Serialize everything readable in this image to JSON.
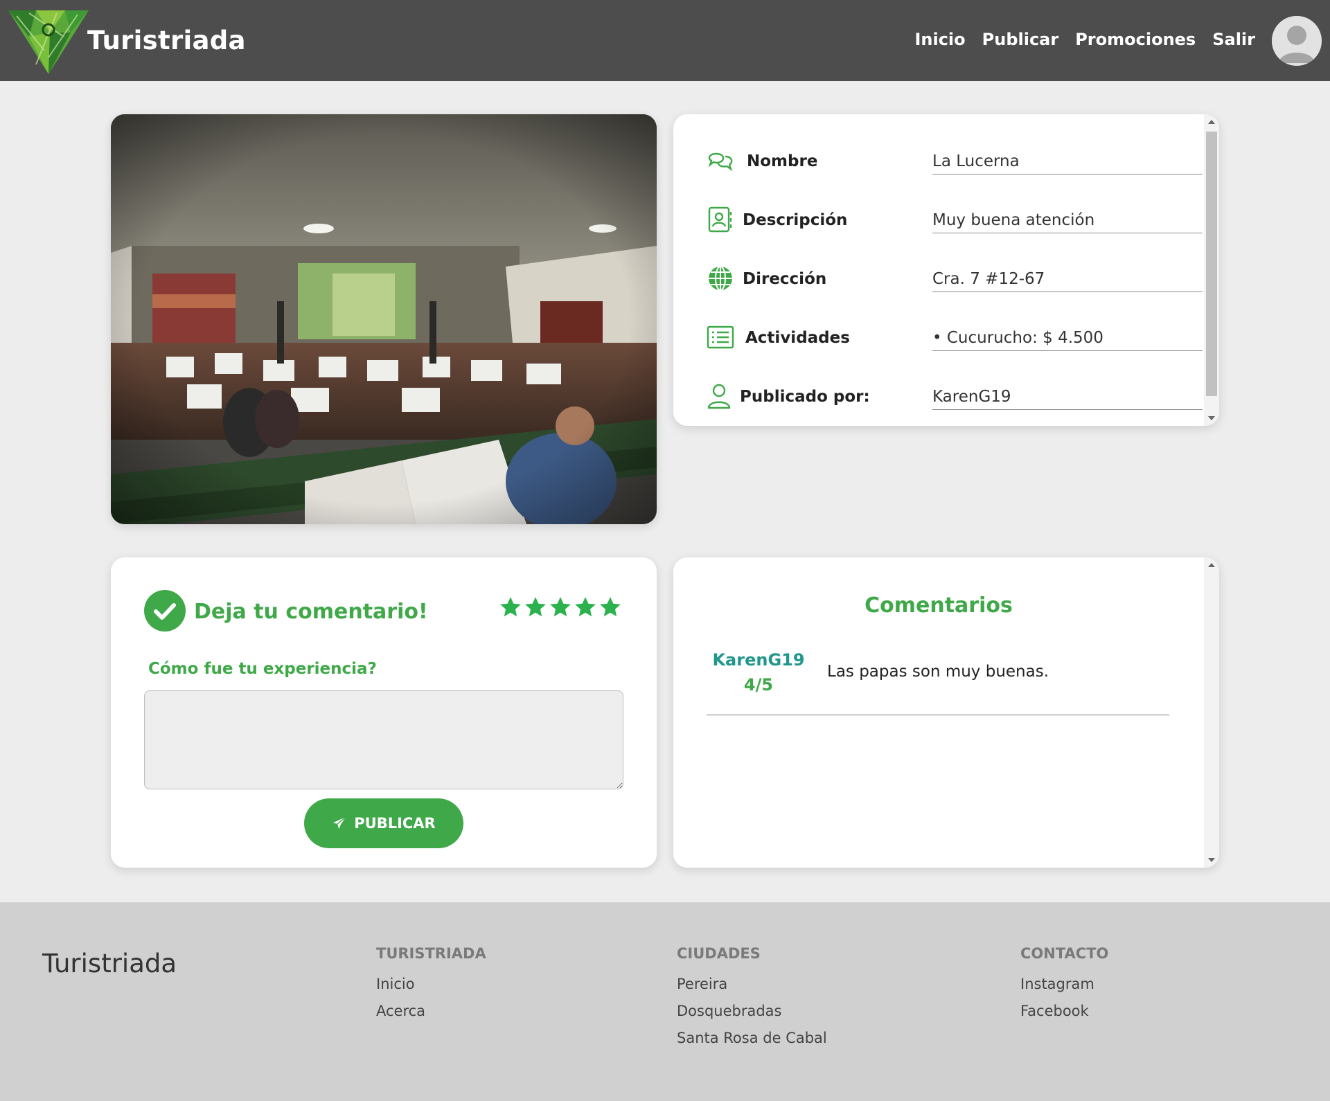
{
  "header": {
    "brand": "Turistriada",
    "nav": [
      {
        "label": "Inicio"
      },
      {
        "label": "Publicar"
      },
      {
        "label": "Promociones"
      },
      {
        "label": "Salir"
      }
    ],
    "avatar_icon": "user-avatar-icon"
  },
  "place": {
    "fields": [
      {
        "icon": "chat-bubbles-icon",
        "label": "Nombre",
        "value": "La Lucerna"
      },
      {
        "icon": "contact-card-icon",
        "label": "Descripción",
        "value": "Muy buena atención"
      },
      {
        "icon": "globe-icon",
        "label": "Dirección",
        "value": "Cra. 7 #12-67"
      },
      {
        "icon": "list-icon",
        "label": "Actividades",
        "value": "• Cucurucho: $ 4.500"
      },
      {
        "icon": "user-icon",
        "label": "Publicado por:",
        "value": "KarenG19"
      }
    ]
  },
  "comment_form": {
    "title": "Deja tu comentario!",
    "question": "Cómo fue tu experiencia?",
    "textarea_value": "",
    "rating": 5,
    "rating_max": 5,
    "publish_label": "PUBLICAR"
  },
  "comments": {
    "title": "Comentarios",
    "items": [
      {
        "user": "KarenG19",
        "score": "4/5",
        "text": "Las papas son muy buenas."
      }
    ]
  },
  "footer": {
    "brand": "Turistriada",
    "columns": [
      {
        "heading": "TURISTRIADA",
        "links": [
          "Inicio",
          "Acerca"
        ]
      },
      {
        "heading": "CIUDADES",
        "links": [
          "Pereira",
          "Dosquebradas",
          "Santa Rosa de Cabal"
        ]
      },
      {
        "heading": "CONTACTO",
        "links": [
          "Instagram",
          "Facebook"
        ]
      }
    ]
  },
  "colors": {
    "accent": "#3fa848",
    "teal": "#21968a",
    "navbar": "#4d4d4d",
    "footer": "#d0d0d0",
    "star": "#2bb24c"
  }
}
